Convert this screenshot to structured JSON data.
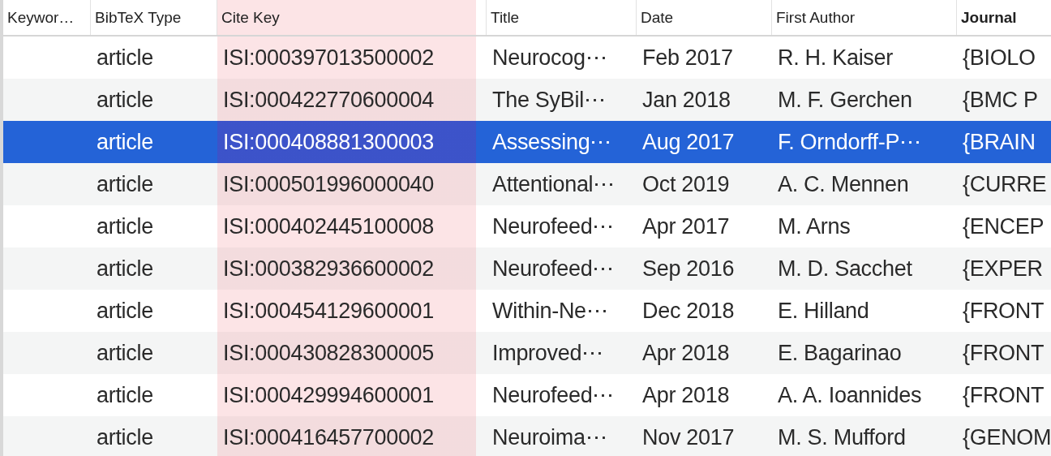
{
  "table": {
    "columns": [
      {
        "label": "Keywor…",
        "highlighted": false,
        "bold": false
      },
      {
        "label": "BibTeX Type",
        "highlighted": false,
        "bold": false
      },
      {
        "label": "Cite Key",
        "highlighted": true,
        "bold": false
      },
      {
        "label": "Title",
        "highlighted": false,
        "bold": false
      },
      {
        "label": "Date",
        "highlighted": false,
        "bold": false
      },
      {
        "label": "First Author",
        "highlighted": false,
        "bold": false
      },
      {
        "label": "Journal",
        "highlighted": false,
        "bold": true
      }
    ],
    "rows": [
      {
        "selected": false,
        "cells": [
          "",
          "article",
          "ISI:000397013500002",
          "Neurocog⋯",
          "Feb 2017",
          "R. H. Kaiser",
          "{BIOLO"
        ]
      },
      {
        "selected": false,
        "cells": [
          "",
          "article",
          "ISI:000422770600004",
          "The SyBil⋯",
          "Jan 2018",
          "M. F. Gerchen",
          "{BMC P"
        ]
      },
      {
        "selected": true,
        "cells": [
          "",
          "article",
          "ISI:000408881300003",
          "Assessing⋯",
          "Aug 2017",
          "F. Orndorff-P⋯",
          "{BRAIN"
        ]
      },
      {
        "selected": false,
        "cells": [
          "",
          "article",
          "ISI:000501996000040",
          "Attentional⋯",
          "Oct 2019",
          "A. C. Mennen",
          "{CURRE"
        ]
      },
      {
        "selected": false,
        "cells": [
          "",
          "article",
          "ISI:000402445100008",
          "Neurofeed⋯",
          "Apr 2017",
          "M. Arns",
          "{ENCEP"
        ]
      },
      {
        "selected": false,
        "cells": [
          "",
          "article",
          "ISI:000382936600002",
          "Neurofeed⋯",
          "Sep 2016",
          "M. D. Sacchet",
          "{EXPER"
        ]
      },
      {
        "selected": false,
        "cells": [
          "",
          "article",
          "ISI:000454129600001",
          "Within-Ne⋯",
          "Dec 2018",
          "E. Hilland",
          "{FRONT"
        ]
      },
      {
        "selected": false,
        "cells": [
          "",
          "article",
          "ISI:000430828300005",
          "Improved⋯",
          "Apr 2018",
          "E. Bagarinao",
          "{FRONT"
        ]
      },
      {
        "selected": false,
        "cells": [
          "",
          "article",
          "ISI:000429994600001",
          "Neurofeed⋯",
          "Apr 2018",
          "A. A. Ioannides",
          "{FRONT"
        ]
      },
      {
        "selected": false,
        "cells": [
          "",
          "article",
          "ISI:000416457700002",
          "Neuroima⋯",
          "Nov 2017",
          "M. S. Mufford",
          "{GENOM"
        ]
      }
    ]
  }
}
